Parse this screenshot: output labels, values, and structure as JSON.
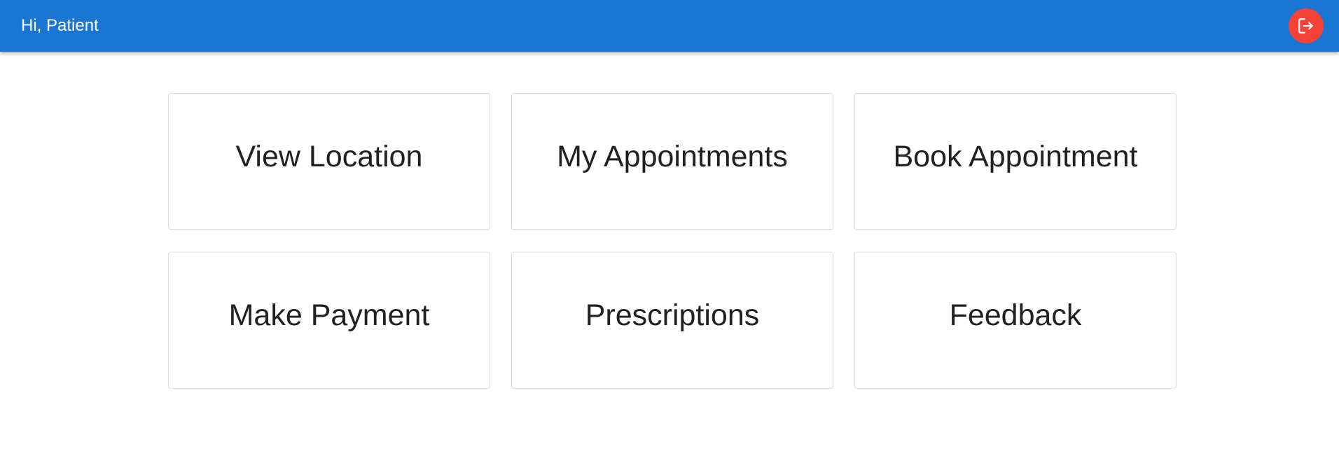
{
  "header": {
    "greeting": "Hi, Patient",
    "background_color": "#1976d2",
    "logout_icon": "logout-icon",
    "logout_color": "#f44336"
  },
  "menu": {
    "cards": [
      {
        "label": "View Location"
      },
      {
        "label": "My Appointments"
      },
      {
        "label": "Book Appointment"
      },
      {
        "label": "Make Payment"
      },
      {
        "label": "Prescriptions"
      },
      {
        "label": "Feedback"
      }
    ]
  }
}
